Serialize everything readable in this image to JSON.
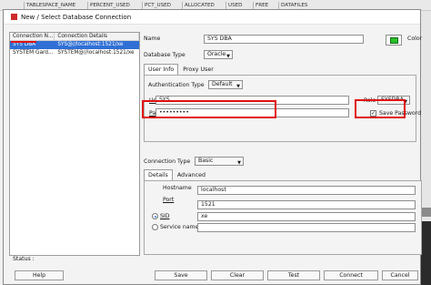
{
  "background": {
    "columns": [
      "TABLESPACE_NAME",
      "PERCENT_USED",
      "PCT_USED",
      "ALLOCATED",
      "USED",
      "FREE",
      "DATAFILES"
    ]
  },
  "dialog": {
    "title": "New / Select Database Connection",
    "list": {
      "headers": [
        "Connection N...",
        "Connection Details"
      ],
      "rows": [
        {
          "name": "SYS DBA",
          "details": "SYS@//localhost:1521/xe",
          "selected": true
        },
        {
          "name": "SYSTEM Gard...",
          "details": "SYSTEM@//localhost:1521/xe",
          "selected": false
        }
      ]
    },
    "form": {
      "name_label": "Name",
      "name_value": "SYS DBA",
      "color_label": "Color",
      "color_value": "#28c028",
      "db_type_label": "Database Type",
      "db_type_value": "Oracle",
      "tabs": [
        "User Info",
        "Proxy User"
      ],
      "auth_type_label": "Authentication Type",
      "auth_type_value": "Default",
      "username_label": "Username",
      "username_value": "SYS",
      "role_label": "Role",
      "role_value": "SYSDBA",
      "password_label": "Password",
      "password_value": "•••••••••",
      "save_password_label": "Save Password",
      "save_password_checked": true,
      "conn_type_label": "Connection Type",
      "conn_type_value": "Basic",
      "details_tabs": [
        "Details",
        "Advanced"
      ],
      "hostname_label": "Hostname",
      "hostname_value": "localhost",
      "port_label": "Port",
      "port_value": "1521",
      "sid_label": "SID",
      "sid_value": "xe",
      "service_name_label": "Service name",
      "service_name_value": ""
    },
    "status_label": "Status :",
    "buttons": {
      "help": "Help",
      "save": "Save",
      "clear": "Clear",
      "test": "Test",
      "connect": "Connect",
      "cancel": "Cancel"
    }
  }
}
